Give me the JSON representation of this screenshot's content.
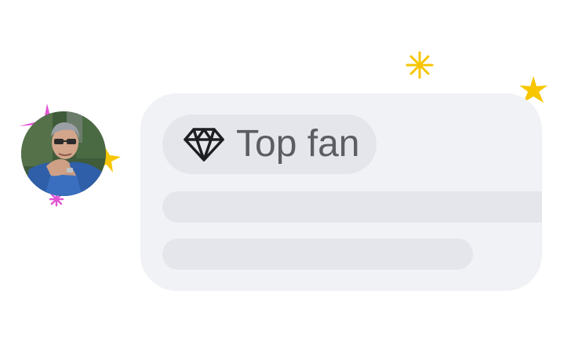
{
  "badge": {
    "label": "Top fan",
    "icon": "diamond-icon"
  },
  "avatar": {
    "icon": "profile-photo"
  },
  "decorations": {
    "sparkle_colors": [
      "#f7c600",
      "#e254d4"
    ]
  }
}
